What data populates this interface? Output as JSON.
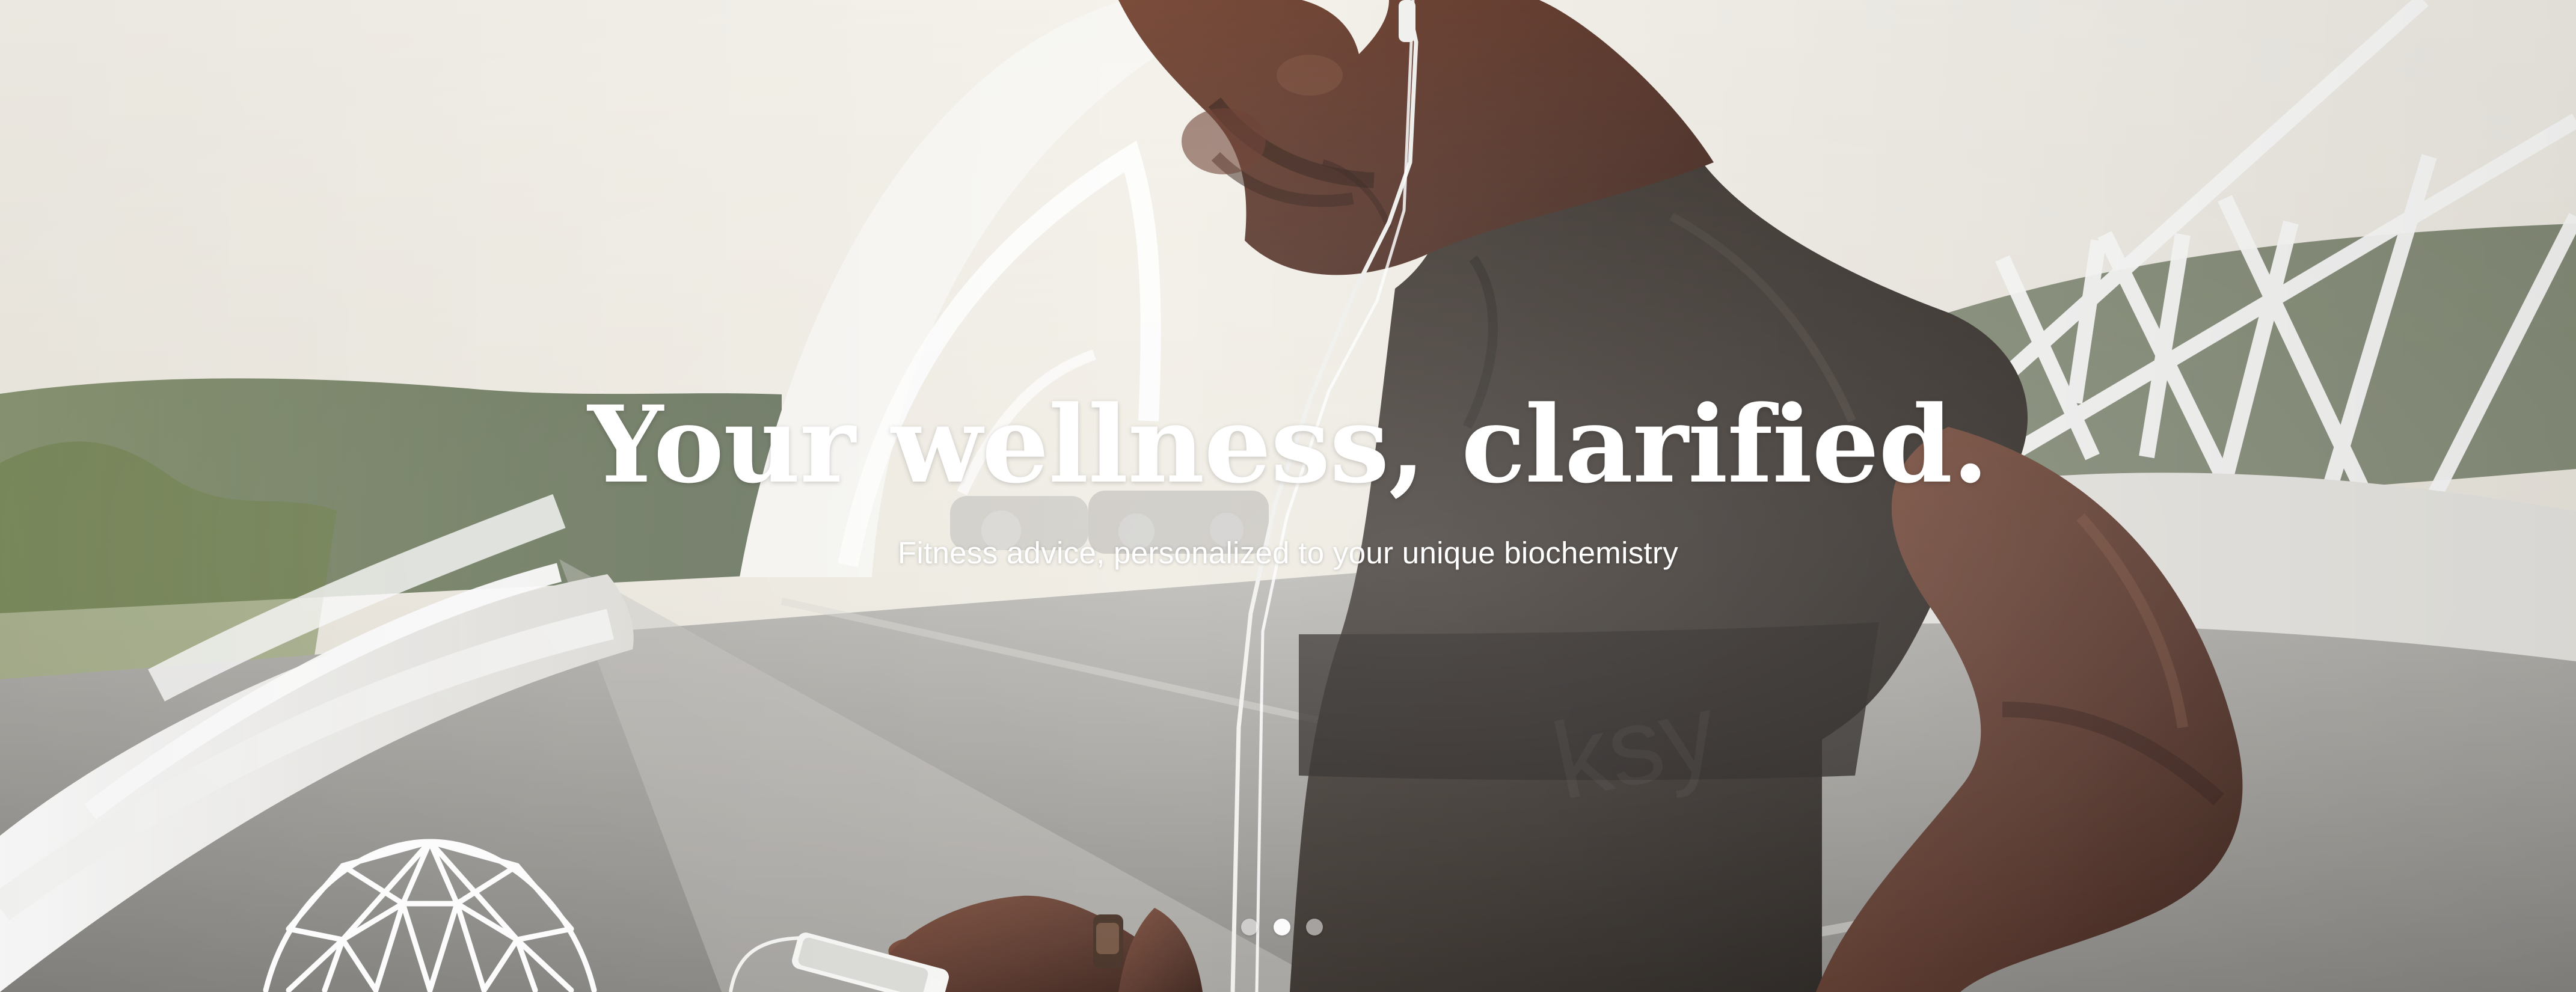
{
  "hero": {
    "title": "Your wellness, clarified.",
    "subtitle": "Fitness advice, personalized to your unique biochemistry",
    "background_scene": "man in black t-shirt with earphones looking at smartphone on a white bridge",
    "logo_icon": "geodesic-dome-icon",
    "carousel": {
      "total": 3,
      "active_index": 1
    },
    "colors": {
      "text": "#ffffff",
      "shirt": "#2a241f",
      "skin": "#5a3425",
      "sky": "#f3f1eb",
      "road": "#9d9c97"
    }
  }
}
